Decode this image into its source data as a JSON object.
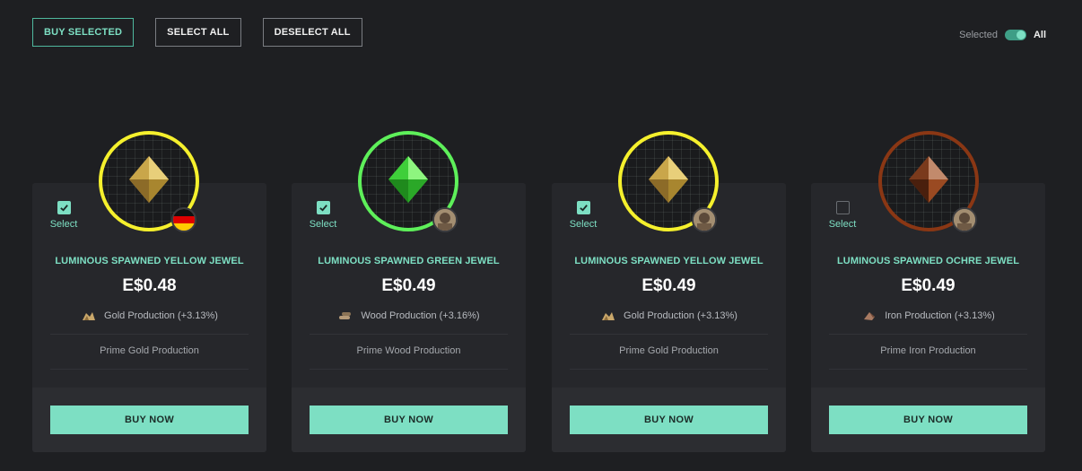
{
  "toolbar": {
    "buy_selected": "BUY SELECTED",
    "select_all": "SELECT ALL",
    "deselect_all": "DESELECT ALL"
  },
  "filter": {
    "selected_label": "Selected",
    "all_label": "All",
    "state": "All"
  },
  "colors": {
    "accent": "#7ddfc3",
    "yellow": "#f5f02d",
    "green": "#5ef05a",
    "ochre": "#8a3714"
  },
  "cards": [
    {
      "selected": true,
      "select_label": "Select",
      "title": "LUMINOUS SPAWNED YELLOW JEWEL",
      "price": "E$0.48",
      "production": "Gold Production (+3.13%)",
      "prime": "Prime Gold Production",
      "buy_label": "BUY NOW",
      "ring_color": "#f5f02d",
      "gem": "yellow-jewel-icon",
      "badge": "germany-flag-icon"
    },
    {
      "selected": true,
      "select_label": "Select",
      "title": "LUMINOUS SPAWNED GREEN JEWEL",
      "price": "E$0.49",
      "production": "Wood Production (+3.16%)",
      "prime": "Prime Wood Production",
      "buy_label": "BUY NOW",
      "ring_color": "#5ef05a",
      "gem": "green-jewel-icon",
      "badge": "owner-avatar-icon"
    },
    {
      "selected": true,
      "select_label": "Select",
      "title": "LUMINOUS SPAWNED YELLOW JEWEL",
      "price": "E$0.49",
      "production": "Gold Production (+3.13%)",
      "prime": "Prime Gold Production",
      "buy_label": "BUY NOW",
      "ring_color": "#f5f02d",
      "gem": "yellow-jewel-icon",
      "badge": "owner-avatar-icon"
    },
    {
      "selected": false,
      "select_label": "Select",
      "title": "LUMINOUS SPAWNED OCHRE JEWEL",
      "price": "E$0.49",
      "production": "Iron Production (+3.13%)",
      "prime": "Prime Iron Production",
      "buy_label": "BUY NOW",
      "ring_color": "#8a3714",
      "gem": "ochre-jewel-icon",
      "badge": "owner-avatar-icon"
    }
  ]
}
